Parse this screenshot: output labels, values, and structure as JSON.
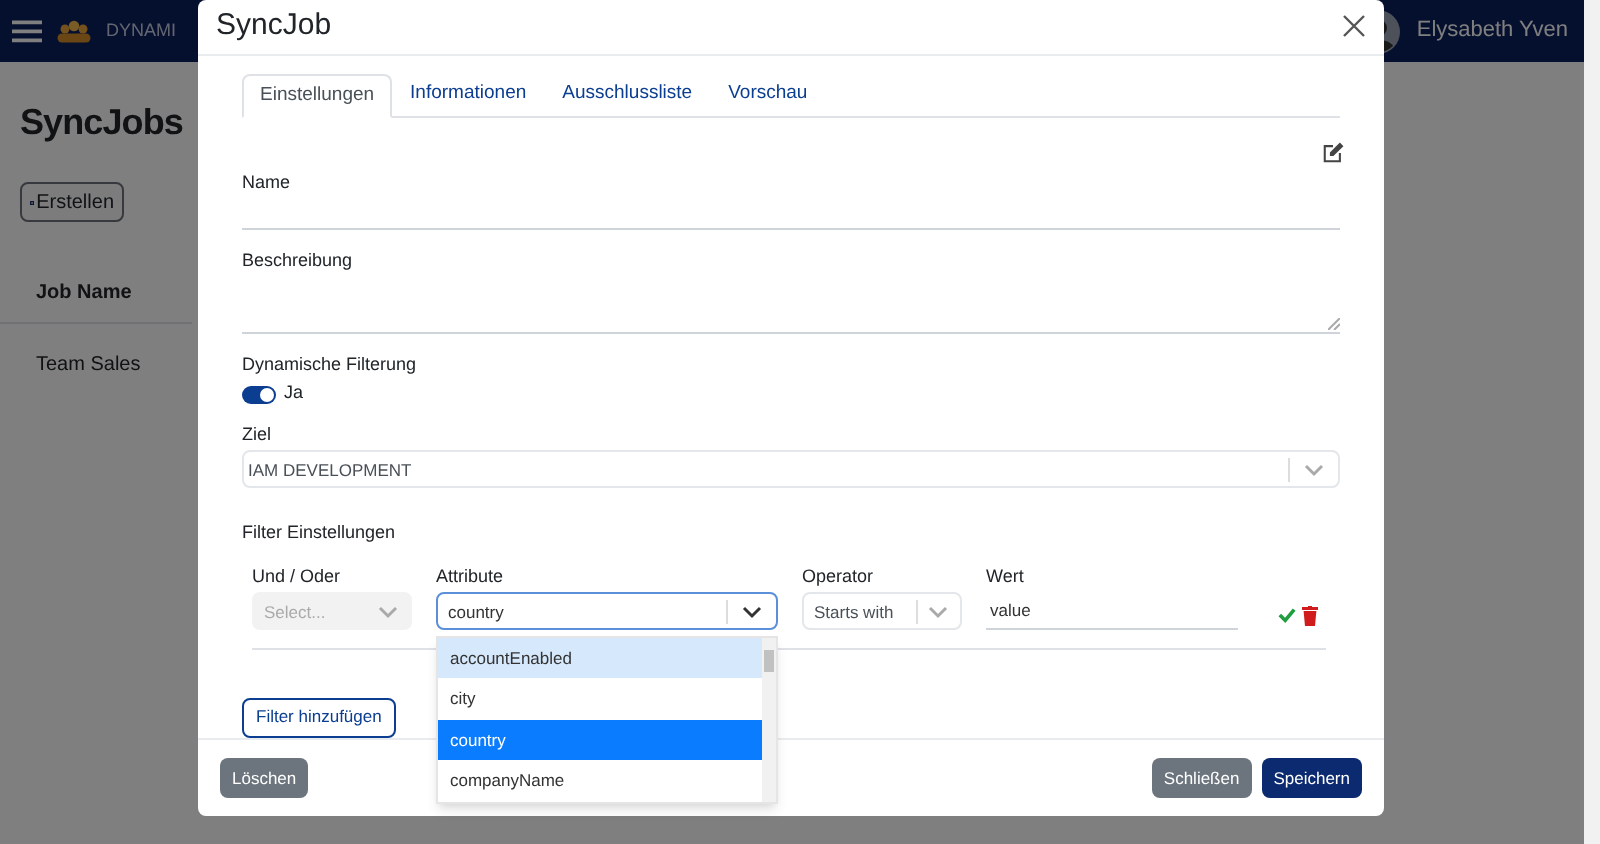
{
  "background": {
    "brand": "DYNAMI",
    "user": "Elysabeth Yven",
    "title": "SyncJobs",
    "create_button": "Erstellen",
    "table": {
      "columns": [
        "Job Name"
      ],
      "rows": [
        [
          "Team Sales"
        ]
      ]
    }
  },
  "dialog": {
    "title": "SyncJob",
    "tabs": [
      {
        "label": "Einstellungen",
        "selected": true
      },
      {
        "label": "Informationen",
        "selected": false
      },
      {
        "label": "Ausschlussliste",
        "selected": false
      },
      {
        "label": "Vorschau",
        "selected": false
      }
    ],
    "name": {
      "label": "Name"
    },
    "description": {
      "label": "Beschreibung"
    },
    "dynamic_filter": {
      "label": "Dynamische Filterung",
      "on": true,
      "text": "Ja"
    },
    "target": {
      "label": "Ziel",
      "value": "IAM DEVELOPMENT"
    },
    "filter": {
      "heading": "Filter Einstellungen",
      "and_or": {
        "label": "Und / Oder",
        "placeholder": "Select...",
        "disabled": true
      },
      "attribute": {
        "label": "Attribute",
        "value": "country",
        "expanded": true,
        "options": [
          {
            "label": "accountEnabled",
            "focused": true,
            "selected": false
          },
          {
            "label": "city",
            "focused": false,
            "selected": false
          },
          {
            "label": "country",
            "focused": false,
            "selected": true
          },
          {
            "label": "companyName",
            "focused": false,
            "selected": false
          }
        ]
      },
      "operator": {
        "label": "Operator",
        "value": "Starts with"
      },
      "value": {
        "label": "Wert",
        "value": "value"
      },
      "add_button": "Filter hinzufügen"
    },
    "buttons": [
      {
        "label": "Löschen",
        "kind": "secondary"
      },
      {
        "label": "Schließen",
        "kind": "secondary"
      },
      {
        "label": "Speichern",
        "kind": "primary"
      }
    ]
  }
}
